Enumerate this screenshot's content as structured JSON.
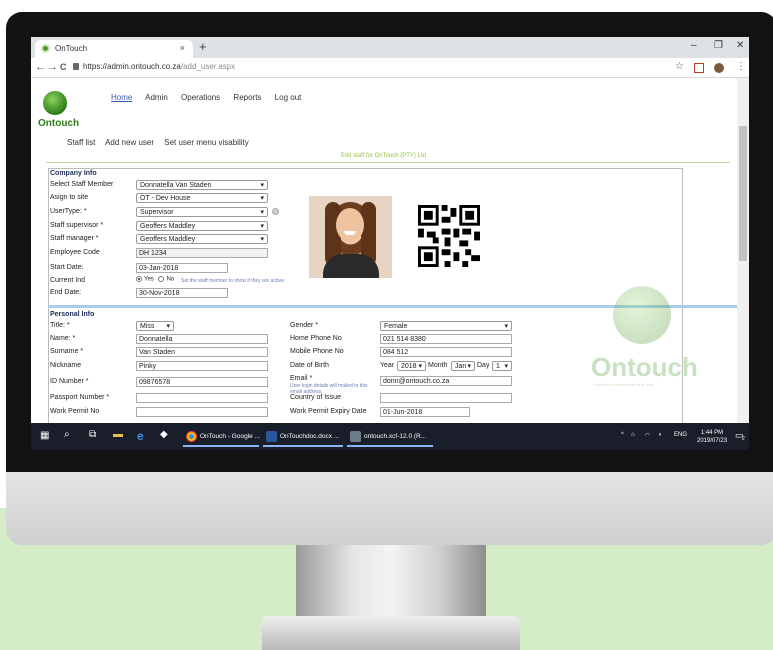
{
  "browser": {
    "tab_title": "OnTouch",
    "tab_close": "×",
    "new_tab": "+",
    "url_host": "https://admin.ontouch.co.za",
    "url_path": "/add_user.aspx",
    "back": "←",
    "forward": "→",
    "reload": "C",
    "minimize": "–",
    "maximize": "❐",
    "close": "✕",
    "star": "☆",
    "menu_dots": "⋮"
  },
  "logo": {
    "text": "Ontouch"
  },
  "top_menu": {
    "home": "Home",
    "admin": "Admin",
    "operations": "Operations",
    "reports": "Reports",
    "logout": "Log out"
  },
  "sub_menu": {
    "staff_list": "Staff list",
    "add_new_user": "Add new user",
    "set_user_menu": "Set user menu visability"
  },
  "edit_caption": "Edit staff for OnTouch (PTY) Ltd",
  "company_info": {
    "title": "Company Info",
    "select_staff_label": "Select Staff Member",
    "select_staff_value": "Donnatella Van Staden",
    "assign_site_label": "Asign to site",
    "assign_site_value": "OT - Dev House",
    "usertype_label": "UserType: *",
    "usertype_value": "Supervisor",
    "supervisor_label": "Staff supervisor *",
    "supervisor_value": "Geoffers Maddley",
    "manager_label": "Staff manager *",
    "manager_value": "Geoffers Maddley",
    "emp_code_label": "Employee Code",
    "emp_code_value": "DH 1234",
    "start_date_label": "Start Date:",
    "start_date_value": "03-Jan-2018",
    "current_ind_label": "Current Ind",
    "yes": "Yes",
    "no": "No",
    "current_hint": "Set the staff member to show if they are active.",
    "end_date_label": "End Date:",
    "end_date_value": "30-Nov-2018"
  },
  "personal_info": {
    "title": "Personal Info",
    "title_label": "Title: *",
    "title_value": "Miss",
    "name_label": "Name: *",
    "name_value": "Donnatella",
    "surname_label": "Surname *",
    "surname_value": "Van Staden",
    "nickname_label": "Nickname",
    "nickname_value": "Pinky",
    "id_label": "ID Number *",
    "id_value": "09876578",
    "passport_label": "Passport Number *",
    "passport_value": "",
    "work_permit_label": "Work Permit No",
    "work_permit_value": "",
    "gender_label": "Gender *",
    "gender_value": "Female",
    "home_phone_label": "Home Phone No",
    "home_phone_value": "021 514 8380",
    "mobile_label": "Mobile Phone No",
    "mobile_value": "084 512",
    "dob_label": "Date of Birth",
    "dob_year_label": "Year",
    "dob_year_value": "2018",
    "dob_month_label": "Month",
    "dob_month_value": "Jan",
    "dob_day_label": "Day",
    "dob_day_value": "1",
    "email_label": "Email *",
    "email_hint": "User login details will mailed to this email address",
    "email_value": "donn@ontouch.co.za",
    "country_label": "Country of Issue",
    "country_value": "",
    "permit_expiry_label": "Work Permit Expiry Date",
    "permit_expiry_value": "01-Jun-2018"
  },
  "watermark": {
    "text": "Ontouch",
    "tagline": "Workforce management at its best"
  },
  "taskbar": {
    "chrome_label": "OnTouch - Google ...",
    "word_label": "OnTouchdoc.docx ...",
    "app3_label": "ontouch.xcf-12.0 (R...",
    "lang": "ENG",
    "time": "1:44 PM",
    "date": "2019/07/23",
    "notif_count": "2"
  },
  "colors": {
    "brand_green": "#2f7d1a",
    "caption_green": "#8fc23f",
    "link_blue": "#3a5fb0",
    "section_title": "#1f2e5a",
    "taskbar": "#1a1d2a",
    "background_green": "#d4edc6"
  }
}
